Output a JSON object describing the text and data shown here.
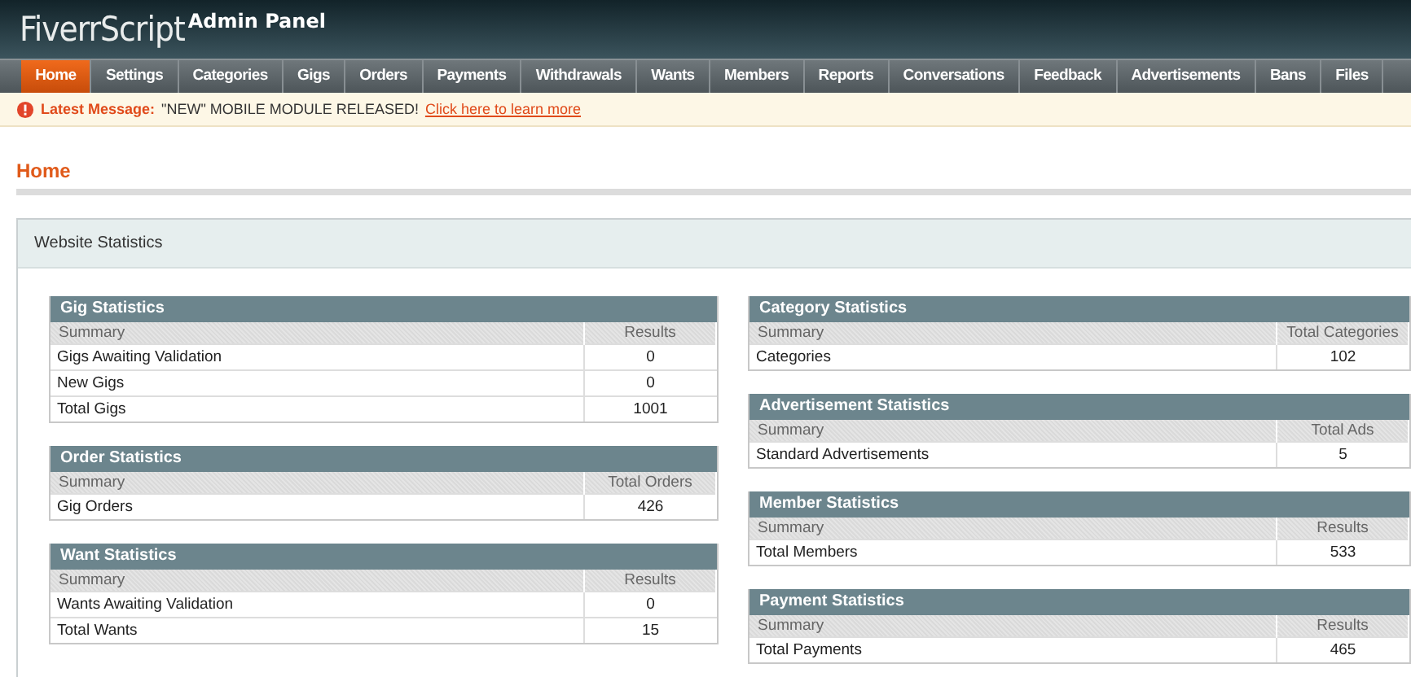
{
  "header": {
    "logo": "FiverrScript",
    "subtitle": "Admin Panel"
  },
  "nav": [
    {
      "label": "Home",
      "selected": true
    },
    {
      "label": "Settings",
      "selected": false
    },
    {
      "label": "Categories",
      "selected": false
    },
    {
      "label": "Gigs",
      "selected": false
    },
    {
      "label": "Orders",
      "selected": false
    },
    {
      "label": "Payments",
      "selected": false
    },
    {
      "label": "Withdrawals",
      "selected": false
    },
    {
      "label": "Wants",
      "selected": false
    },
    {
      "label": "Members",
      "selected": false
    },
    {
      "label": "Reports",
      "selected": false
    },
    {
      "label": "Conversations",
      "selected": false
    },
    {
      "label": "Feedback",
      "selected": false
    },
    {
      "label": "Advertisements",
      "selected": false
    },
    {
      "label": "Bans",
      "selected": false
    },
    {
      "label": "Files",
      "selected": false
    }
  ],
  "message": {
    "label": "Latest Message:",
    "text": "\"NEW\" MOBILE MODULE RELEASED!",
    "link": "Click here to learn more"
  },
  "page_title": "Home",
  "panel": {
    "title": "Website Statistics",
    "columns": [
      [
        {
          "title": "Gig Statistics",
          "headers": [
            "Summary",
            "Results"
          ],
          "rows": [
            [
              "Gigs Awaiting Validation",
              "0"
            ],
            [
              "New Gigs",
              "0"
            ],
            [
              "Total Gigs",
              "1001"
            ]
          ]
        },
        {
          "title": "Order Statistics",
          "headers": [
            "Summary",
            "Total Orders"
          ],
          "rows": [
            [
              "Gig Orders",
              "426"
            ]
          ]
        },
        {
          "title": "Want Statistics",
          "headers": [
            "Summary",
            "Results"
          ],
          "rows": [
            [
              "Wants Awaiting Validation",
              "0"
            ],
            [
              "Total Wants",
              "15"
            ]
          ]
        }
      ],
      [
        {
          "title": "Category Statistics",
          "headers": [
            "Summary",
            "Total Categories"
          ],
          "rows": [
            [
              "Categories",
              "102"
            ]
          ]
        },
        {
          "title": "Advertisement Statistics",
          "headers": [
            "Summary",
            "Total Ads"
          ],
          "rows": [
            [
              "Standard Advertisements",
              "5"
            ]
          ]
        },
        {
          "title": "Member Statistics",
          "headers": [
            "Summary",
            "Results"
          ],
          "rows": [
            [
              "Total Members",
              "533"
            ]
          ]
        },
        {
          "title": "Payment Statistics",
          "headers": [
            "Summary",
            "Results"
          ],
          "rows": [
            [
              "Total Payments",
              "465"
            ]
          ]
        }
      ]
    ]
  }
}
